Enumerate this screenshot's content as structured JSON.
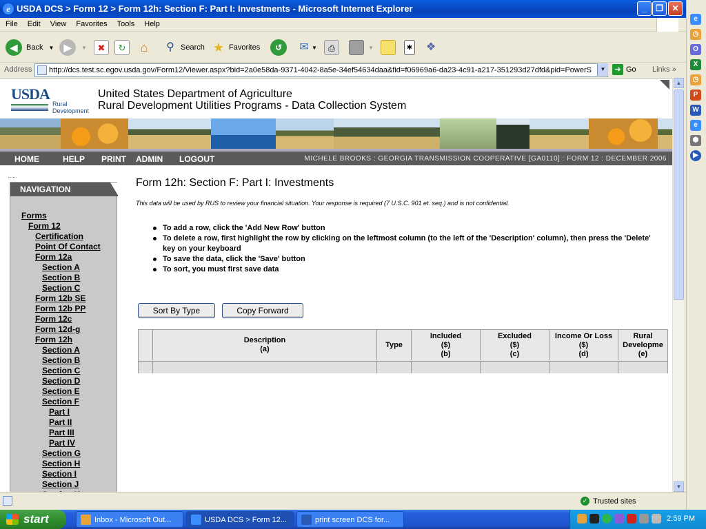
{
  "window": {
    "title": "USDA DCS > Form 12 > Form 12h: Section F: Part I: Investments - Microsoft Internet Explorer"
  },
  "menu": [
    "File",
    "Edit",
    "View",
    "Favorites",
    "Tools",
    "Help"
  ],
  "toolbar": {
    "back_label": "Back",
    "search_label": "Search",
    "favorites_label": "Favorites"
  },
  "address": {
    "label": "Address",
    "url": "http://dcs.test.sc.egov.usda.gov/Form12/Viewer.aspx?bid=2a0e58da-9371-4042-8a5e-34ef54634daa&fid=f06969a6-da23-4c91-a217-351293d27dfd&pid=PowerS",
    "go_label": "Go",
    "links_label": "Links"
  },
  "header": {
    "logo_text": "USDA",
    "logo_sub": "Rural Development",
    "title_line1": "United States Department of Agriculture",
    "title_line2": "Rural Development Utilities Programs - Data Collection System"
  },
  "topnav": {
    "links": [
      "HOME",
      "HELP",
      "PRINT",
      "ADMIN",
      "LOGOUT"
    ],
    "user_info": "MICHELE BROOKS : GEORGIA TRANSMISSION COOPERATIVE [GA0110] : FORM 12 : DECEMBER 2006"
  },
  "navigation": {
    "heading": "NAVIGATION",
    "items": [
      {
        "label": "Forms",
        "level": 0
      },
      {
        "label": "Form 12",
        "level": 1
      },
      {
        "label": "Certification",
        "level": 2
      },
      {
        "label": "Point Of Contact",
        "level": 2
      },
      {
        "label": "Form 12a",
        "level": 2
      },
      {
        "label": "Section A",
        "level": 3
      },
      {
        "label": "Section B",
        "level": 3
      },
      {
        "label": "Section C",
        "level": 3
      },
      {
        "label": "Form 12b SE",
        "level": 2
      },
      {
        "label": "Form 12b PP",
        "level": 2
      },
      {
        "label": "Form 12c",
        "level": 2
      },
      {
        "label": "Form 12d-g",
        "level": 2
      },
      {
        "label": "Form 12h",
        "level": 2
      },
      {
        "label": "Section A",
        "level": 3
      },
      {
        "label": "Section B",
        "level": 3
      },
      {
        "label": "Section C",
        "level": 3
      },
      {
        "label": "Section D",
        "level": 3
      },
      {
        "label": "Section E",
        "level": 3
      },
      {
        "label": "Section F",
        "level": 3
      },
      {
        "label": "Part I",
        "level": 4
      },
      {
        "label": "Part II",
        "level": 4
      },
      {
        "label": "Part III",
        "level": 4
      },
      {
        "label": "Part IV",
        "level": 4
      },
      {
        "label": "Section G",
        "level": 3
      },
      {
        "label": "Section H",
        "level": 3
      },
      {
        "label": "Section I",
        "level": 3
      },
      {
        "label": "Section J",
        "level": 3
      },
      {
        "label": "Section K",
        "level": 3
      }
    ]
  },
  "main": {
    "title": "Form 12h: Section F: Part I: Investments",
    "disclaimer": "This data will be used by RUS to review your financial situation. Your response is required (7 U.S.C. 901 et. seq.) and is not confidential.",
    "instructions": [
      "To add a row, click the 'Add New Row' button",
      "To delete a row, first highlight the row by clicking on the leftmost column (to the left of the 'Description' column), then press the 'Delete' key on your keyboard",
      "To save the data, click the 'Save' button",
      "To sort, you must first save data"
    ],
    "sort_button": "Sort By Type",
    "copy_button": "Copy Forward",
    "grid": {
      "columns": [
        {
          "l1": "",
          "l2": "",
          "l3": ""
        },
        {
          "l1": "Description",
          "l2": "(a)",
          "l3": ""
        },
        {
          "l1": "Type",
          "l2": "",
          "l3": ""
        },
        {
          "l1": "Included",
          "l2": "($)",
          "l3": "(b)"
        },
        {
          "l1": "Excluded",
          "l2": "($)",
          "l3": "(c)"
        },
        {
          "l1": "Income Or Loss",
          "l2": "($)",
          "l3": "(d)"
        },
        {
          "l1": "Rural",
          "l2": "Developme",
          "l3": "(e)"
        }
      ]
    }
  },
  "status": {
    "zone": "Trusted sites"
  },
  "taskbar": {
    "start_label": "start",
    "tasks": [
      "Inbox - Microsoft Out...",
      "USDA DCS > Form 12...",
      "print screen DCS for..."
    ],
    "time": "2:59 PM"
  }
}
